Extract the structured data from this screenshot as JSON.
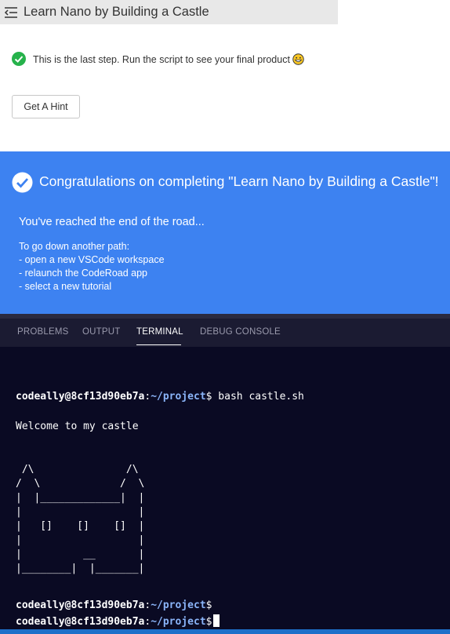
{
  "header": {
    "title": "Learn Nano by Building a Castle"
  },
  "step": {
    "text": "This is the last step. Run the script to see your final product"
  },
  "hint_button": "Get A Hint",
  "banner": {
    "title": "Congratulations on completing \"Learn Nano by Building a Castle\"!",
    "subtitle": "You've reached the end of the road...",
    "list_title": "To go down another path:",
    "items": [
      "- open a new VSCode workspace",
      "- relaunch the CodeRoad app",
      "- select a new tutorial"
    ]
  },
  "panel_tabs": [
    "PROBLEMS",
    "OUTPUT",
    "TERMINAL",
    "DEBUG CONSOLE"
  ],
  "active_tab": "TERMINAL",
  "terminal": {
    "prompt_user": "codeally@8cf13d90eb7a",
    "prompt_sep": ":",
    "prompt_path": "~/project",
    "prompt_symbol": "$",
    "command": " bash castle.sh",
    "output": "Welcome to my castle",
    "ascii_art": " /\\               /\\\n/  \\             /  \\\n|  |_____________|  |\n|                   |\n|   []    []    []  |\n|                   |\n|          __       |\n|________|  |_______|"
  },
  "colors": {
    "banner": "#3d82f1",
    "terminal_bg": "#0a0a23",
    "check_green": "#26b24b",
    "prompt_path": "#8ab4f8"
  }
}
